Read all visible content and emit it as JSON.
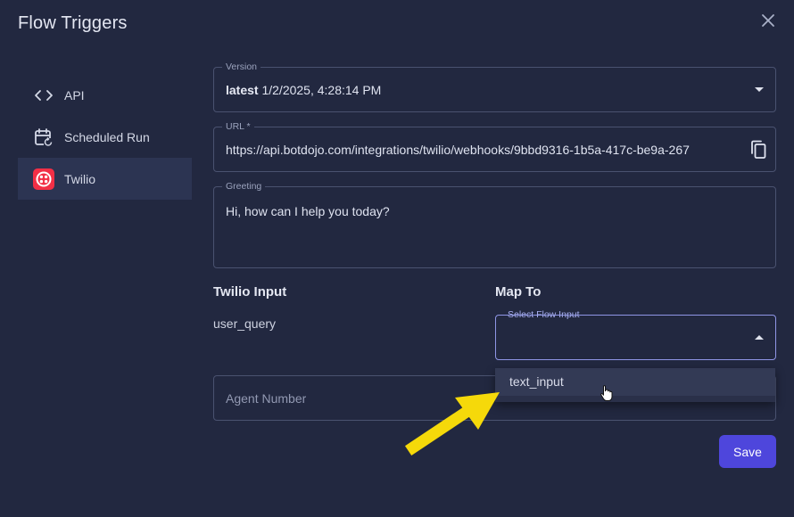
{
  "dialog": {
    "title": "Flow Triggers"
  },
  "sidebar": {
    "items": [
      {
        "label": "API",
        "icon": "code-icon"
      },
      {
        "label": "Scheduled Run",
        "icon": "calendar-refresh-icon"
      },
      {
        "label": "Twilio",
        "icon": "twilio-icon"
      }
    ],
    "active": "Twilio"
  },
  "form": {
    "version": {
      "legend": "Version",
      "tag": "latest",
      "value": "1/2/2025, 4:28:14 PM"
    },
    "url": {
      "legend": "URL *",
      "value": "https://api.botdojo.com/integrations/twilio/webhooks/9bbd9316-1b5a-417c-be9a-267"
    },
    "greeting": {
      "legend": "Greeting",
      "value": "Hi, how can I help you today?"
    },
    "mapping": {
      "input_header": "Twilio Input",
      "map_header": "Map To",
      "input_value": "user_query",
      "select_legend": "Select Flow Input",
      "select_value": "",
      "options": [
        "text_input"
      ]
    },
    "agent_number": {
      "placeholder": "Agent Number"
    },
    "save_label": "Save"
  },
  "colors": {
    "background": "#222840",
    "accent": "#4e46dc",
    "twilio_red": "#f22f46",
    "arrow_yellow": "#f5d90a"
  }
}
